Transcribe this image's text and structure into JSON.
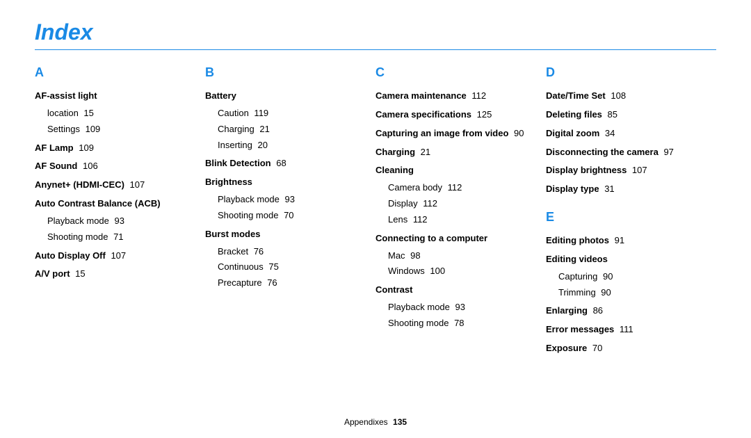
{
  "title": "Index",
  "footer": {
    "label": "Appendixes",
    "page": "135"
  },
  "columns": [
    {
      "sections": [
        {
          "letter": "A",
          "entries": [
            {
              "label": "AF-assist light",
              "subs": [
                {
                  "label": "location",
                  "page": "15"
                },
                {
                  "label": "Settings",
                  "page": "109"
                }
              ]
            },
            {
              "label": "AF Lamp",
              "page": "109"
            },
            {
              "label": "AF Sound",
              "page": "106"
            },
            {
              "label": "Anynet+ (HDMI-CEC)",
              "page": "107"
            },
            {
              "label": "Auto Contrast Balance (ACB)",
              "subs": [
                {
                  "label": "Playback mode",
                  "page": "93"
                },
                {
                  "label": "Shooting mode",
                  "page": "71"
                }
              ]
            },
            {
              "label": "Auto Display Off",
              "page": "107"
            },
            {
              "label": "A/V port",
              "page": "15"
            }
          ]
        }
      ]
    },
    {
      "sections": [
        {
          "letter": "B",
          "entries": [
            {
              "label": "Battery",
              "subs": [
                {
                  "label": "Caution",
                  "page": "119"
                },
                {
                  "label": "Charging",
                  "page": "21"
                },
                {
                  "label": "Inserting",
                  "page": "20"
                }
              ]
            },
            {
              "label": "Blink Detection",
              "page": "68"
            },
            {
              "label": "Brightness",
              "subs": [
                {
                  "label": "Playback mode",
                  "page": "93"
                },
                {
                  "label": "Shooting mode",
                  "page": "70"
                }
              ]
            },
            {
              "label": "Burst modes",
              "subs": [
                {
                  "label": "Bracket",
                  "page": "76"
                },
                {
                  "label": "Continuous",
                  "page": "75"
                },
                {
                  "label": "Precapture",
                  "page": "76"
                }
              ]
            }
          ]
        }
      ]
    },
    {
      "sections": [
        {
          "letter": "C",
          "entries": [
            {
              "label": "Camera maintenance",
              "page": "112"
            },
            {
              "label": "Camera specifications",
              "page": "125"
            },
            {
              "label": "Capturing an image from video",
              "page": "90"
            },
            {
              "label": "Charging",
              "page": "21"
            },
            {
              "label": "Cleaning",
              "subs": [
                {
                  "label": "Camera body",
                  "page": "112"
                },
                {
                  "label": "Display",
                  "page": "112"
                },
                {
                  "label": "Lens",
                  "page": "112"
                }
              ]
            },
            {
              "label": "Connecting to a computer",
              "subs": [
                {
                  "label": "Mac",
                  "page": "98"
                },
                {
                  "label": "Windows",
                  "page": "100"
                }
              ]
            },
            {
              "label": "Contrast",
              "subs": [
                {
                  "label": "Playback mode",
                  "page": "93"
                },
                {
                  "label": "Shooting mode",
                  "page": "78"
                }
              ]
            }
          ]
        }
      ]
    },
    {
      "sections": [
        {
          "letter": "D",
          "entries": [
            {
              "label": "Date/Time Set",
              "page": "108"
            },
            {
              "label": "Deleting files",
              "page": "85"
            },
            {
              "label": "Digital zoom",
              "page": "34"
            },
            {
              "label": "Disconnecting the camera",
              "page": "97"
            },
            {
              "label": "Display brightness",
              "page": "107"
            },
            {
              "label": "Display type",
              "page": "31"
            }
          ]
        },
        {
          "letter": "E",
          "entries": [
            {
              "label": "Editing photos",
              "page": "91"
            },
            {
              "label": "Editing videos",
              "subs": [
                {
                  "label": "Capturing",
                  "page": "90"
                },
                {
                  "label": "Trimming",
                  "page": "90"
                }
              ]
            },
            {
              "label": "Enlarging",
              "page": "86"
            },
            {
              "label": "Error messages",
              "page": "111"
            },
            {
              "label": "Exposure",
              "page": "70"
            }
          ]
        }
      ]
    }
  ]
}
